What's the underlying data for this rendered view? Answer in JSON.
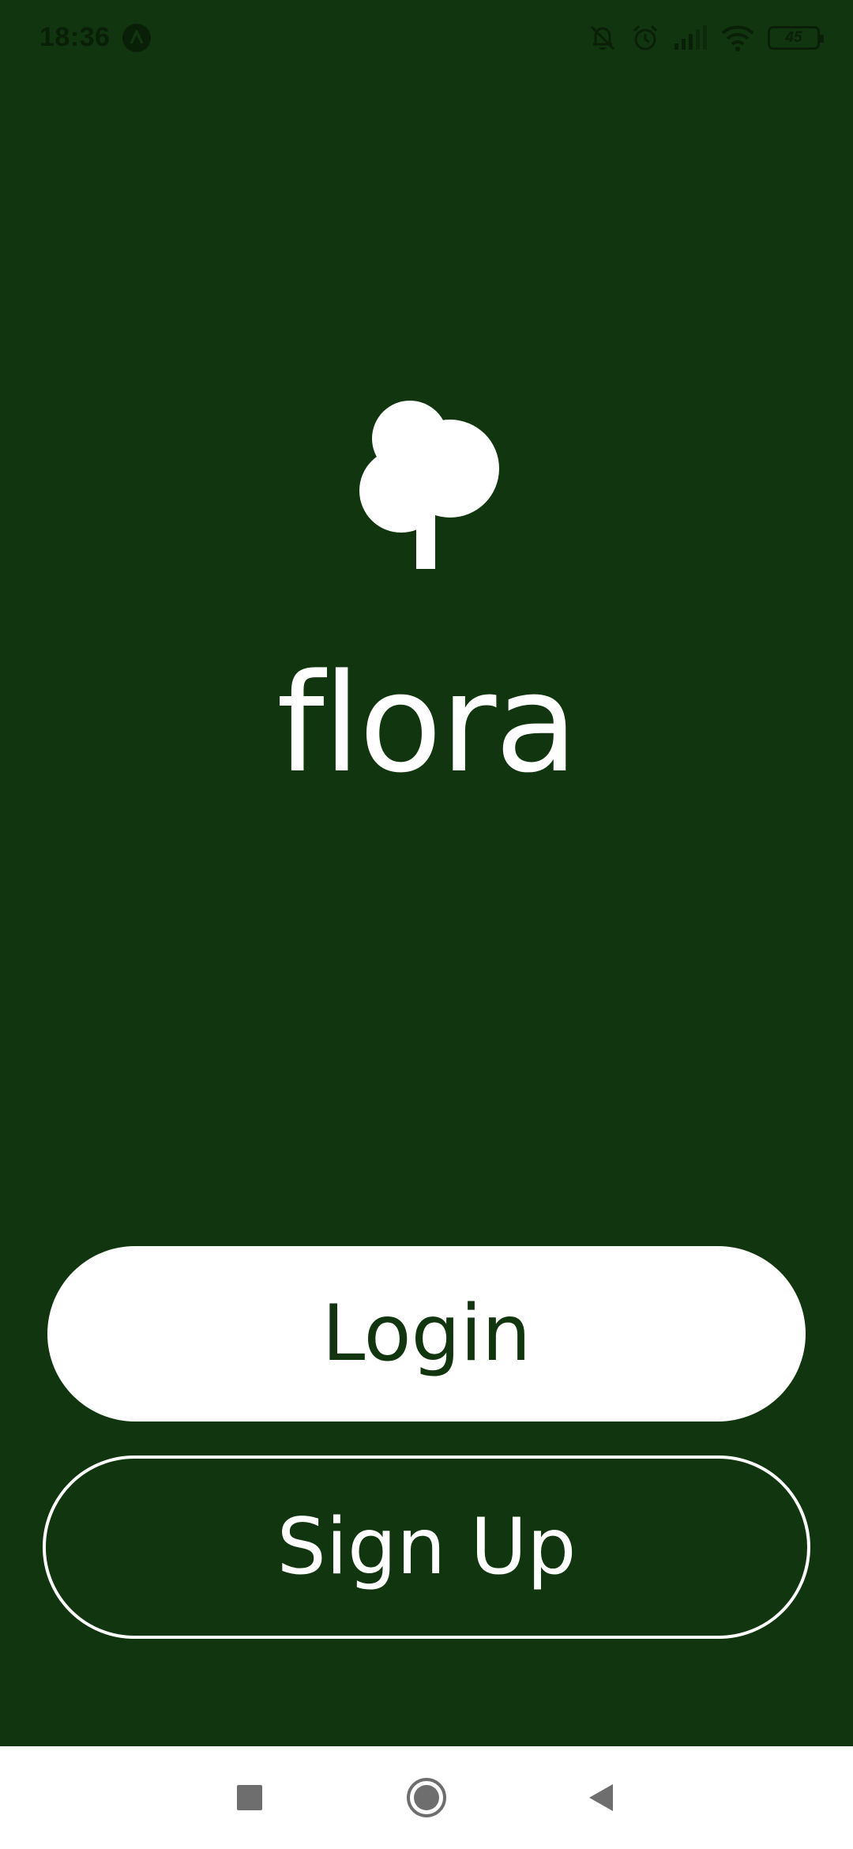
{
  "status_bar": {
    "time": "18:36",
    "battery_level": "45",
    "icons": [
      "app-notification-icon",
      "bell-off-icon",
      "alarm-icon",
      "cellular-signal-icon",
      "wifi-icon",
      "battery-icon"
    ]
  },
  "app": {
    "logo_icon": "tree-icon",
    "name": "flora"
  },
  "actions": {
    "login_label": "Login",
    "signup_label": "Sign Up"
  },
  "navigation": {
    "buttons": [
      "recents-icon",
      "home-icon",
      "back-icon"
    ]
  },
  "colors": {
    "background": "#11350e",
    "primary_button_bg": "#ffffff",
    "primary_button_text": "#11350e",
    "outline_button_border": "#ffffff",
    "nav_bar_bg": "#ffffff"
  }
}
